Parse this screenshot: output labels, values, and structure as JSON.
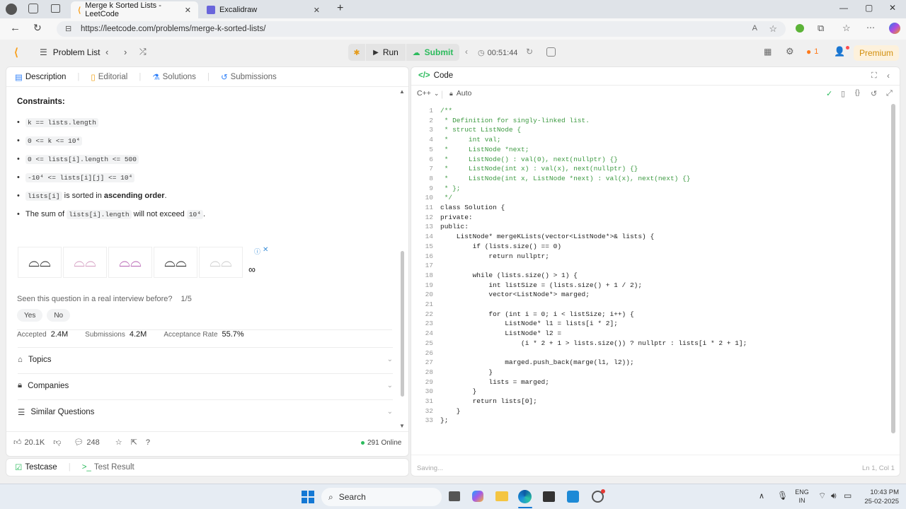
{
  "browser": {
    "tabs": [
      {
        "title": "Merge k Sorted Lists - LeetCode",
        "active": true
      },
      {
        "title": "Excalidraw",
        "active": false
      }
    ],
    "url": "https://leetcode.com/problems/merge-k-sorted-lists/"
  },
  "lc_bar": {
    "problem_list": "Problem List",
    "run": "Run",
    "submit": "Submit",
    "timer": "00:51:44",
    "streak": "1",
    "premium": "Premium"
  },
  "left_tabs": {
    "description": "Description",
    "editorial": "Editorial",
    "solutions": "Solutions",
    "submissions": "Submissions"
  },
  "constraints": {
    "heading": "Constraints:",
    "items": [
      {
        "code": "k == lists.length",
        "text": ""
      },
      {
        "code": "0 <= k <= 10⁴",
        "text": ""
      },
      {
        "code": "0 <= lists[i].length <= 500",
        "text": ""
      },
      {
        "code": "-10⁴ <= lists[i][j] <= 10⁴",
        "text": ""
      },
      {
        "code": "lists[i]",
        "text": " is sorted in ",
        "bold": "ascending order",
        "tail": "."
      },
      {
        "pre": "The sum of ",
        "code": "lists[i].length",
        "text": " will not exceed ",
        "code2": "10⁴",
        "tail": "."
      }
    ]
  },
  "interview": {
    "question": "Seen this question in a real interview before?",
    "count": "1/5",
    "yes": "Yes",
    "no": "No"
  },
  "stats": {
    "accepted_label": "Accepted",
    "accepted": "2.4M",
    "submissions_label": "Submissions",
    "submissions": "4.2M",
    "rate_label": "Acceptance Rate",
    "rate": "55.7%"
  },
  "sections": [
    "Topics",
    "Companies",
    "Similar Questions"
  ],
  "footer": {
    "likes": "20.1K",
    "comments": "248",
    "online": "291 Online"
  },
  "bottom_tabs": {
    "testcase": "Testcase",
    "result": "Test Result"
  },
  "code_panel": {
    "title": "Code",
    "language": "C++",
    "mode": "Auto",
    "status": "Saving...",
    "cursor": "Ln 1, Col 1"
  },
  "code_lines": [
    "/**",
    " * Definition for singly-linked list.",
    " * struct ListNode {",
    " *     int val;",
    " *     ListNode *next;",
    " *     ListNode() : val(0), next(nullptr) {}",
    " *     ListNode(int x) : val(x), next(nullptr) {}",
    " *     ListNode(int x, ListNode *next) : val(x), next(next) {}",
    " * };",
    " */",
    "class Solution {",
    "private:",
    "public:",
    "    ListNode* mergeKLists(vector<ListNode*>& lists) {",
    "        if (lists.size() == 0)",
    "            return nullptr;",
    "",
    "        while (lists.size() > 1) {",
    "            int listSize = (lists.size() + 1 / 2);",
    "            vector<ListNode*> marged;",
    "",
    "            for (int i = 0; i < listSize; i++) {",
    "                ListNode* l1 = lists[i * 2];",
    "                ListNode* l2 =",
    "                    (i * 2 + 1 > lists.size()) ? nullptr : lists[i * 2 + 1];",
    "",
    "                marged.push_back(marge(l1, l2));",
    "            }",
    "            lists = marged;",
    "        }",
    "        return lists[0];",
    "    }",
    "};"
  ],
  "taskbar": {
    "search": "Search",
    "lang1": "ENG",
    "lang2": "IN",
    "time": "10:43 PM",
    "date": "25-02-2025"
  }
}
